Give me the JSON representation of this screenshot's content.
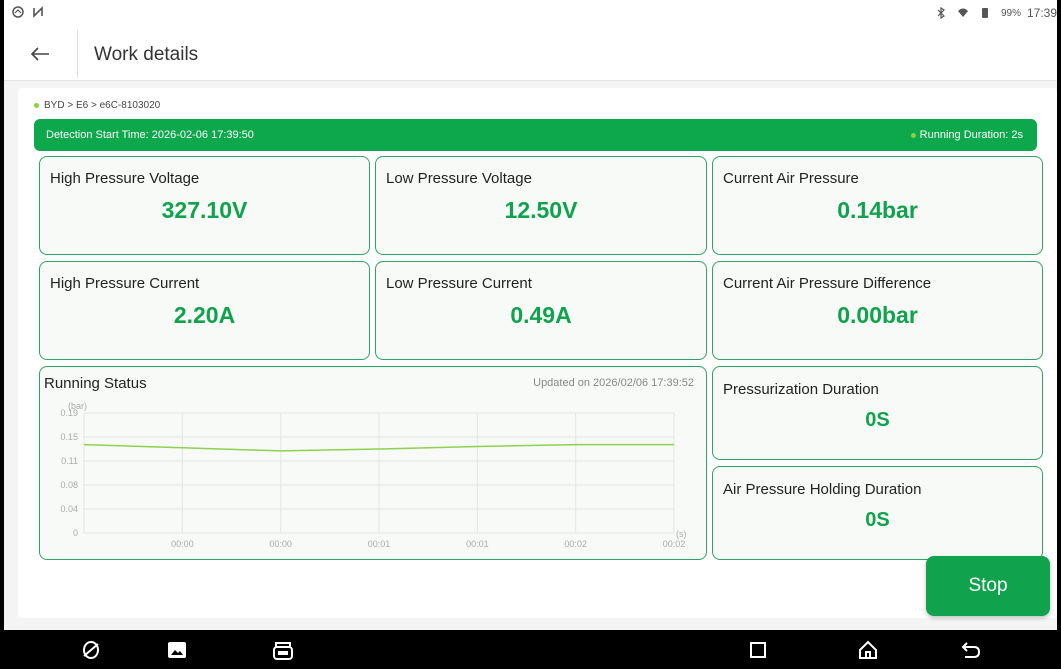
{
  "status_bar": {
    "battery": "99%",
    "time": "17:39"
  },
  "header": {
    "title": "Work details"
  },
  "breadcrumb": "BYD > E6 > e6C-8103020",
  "banner": {
    "start_time": "Detection Start Time: 2026-02-06 17:39:50",
    "running_duration": "Running Duration: 2s"
  },
  "metrics": {
    "high_pressure_voltage": {
      "label": "High Pressure Voltage",
      "value": "327.10V"
    },
    "low_pressure_voltage": {
      "label": "Low Pressure Voltage",
      "value": "12.50V"
    },
    "current_air_pressure": {
      "label": "Current Air Pressure",
      "value": "0.14bar"
    },
    "high_pressure_current": {
      "label": "High Pressure Current",
      "value": "2.20A"
    },
    "low_pressure_current": {
      "label": "Low Pressure Current",
      "value": "0.49A"
    },
    "air_pressure_difference": {
      "label": "Current Air Pressure Difference",
      "value": "0.00bar"
    },
    "pressurization_duration": {
      "label": "Pressurization Duration",
      "value": "0S"
    },
    "holding_duration": {
      "label": "Air Pressure Holding Duration",
      "value": "0S"
    }
  },
  "chart_data": {
    "type": "line",
    "title": "Running Status",
    "updated": "Updated on 2026/02/06 17:39:52",
    "ylabel": "(bar)",
    "xlabel": "(s)",
    "y_ticks": [
      "0",
      "0.04",
      "0.08",
      "0.11",
      "0.15",
      "0.19"
    ],
    "x_ticks": [
      "00:00",
      "00:00",
      "00:01",
      "00:01",
      "00:02",
      "00:02"
    ],
    "ylim": [
      0,
      0.19
    ],
    "series": [
      {
        "values": [
          0.14,
          0.135,
          0.13,
          0.133,
          0.137,
          0.14,
          0.14
        ]
      }
    ],
    "line_color": "#8fd14f",
    "grid": true
  },
  "actions": {
    "stop_label": "Stop"
  },
  "colors": {
    "accent": "#11a24e",
    "banner": "#0da84c",
    "card_border": "#2fa563",
    "dot": "#8dd13f"
  }
}
